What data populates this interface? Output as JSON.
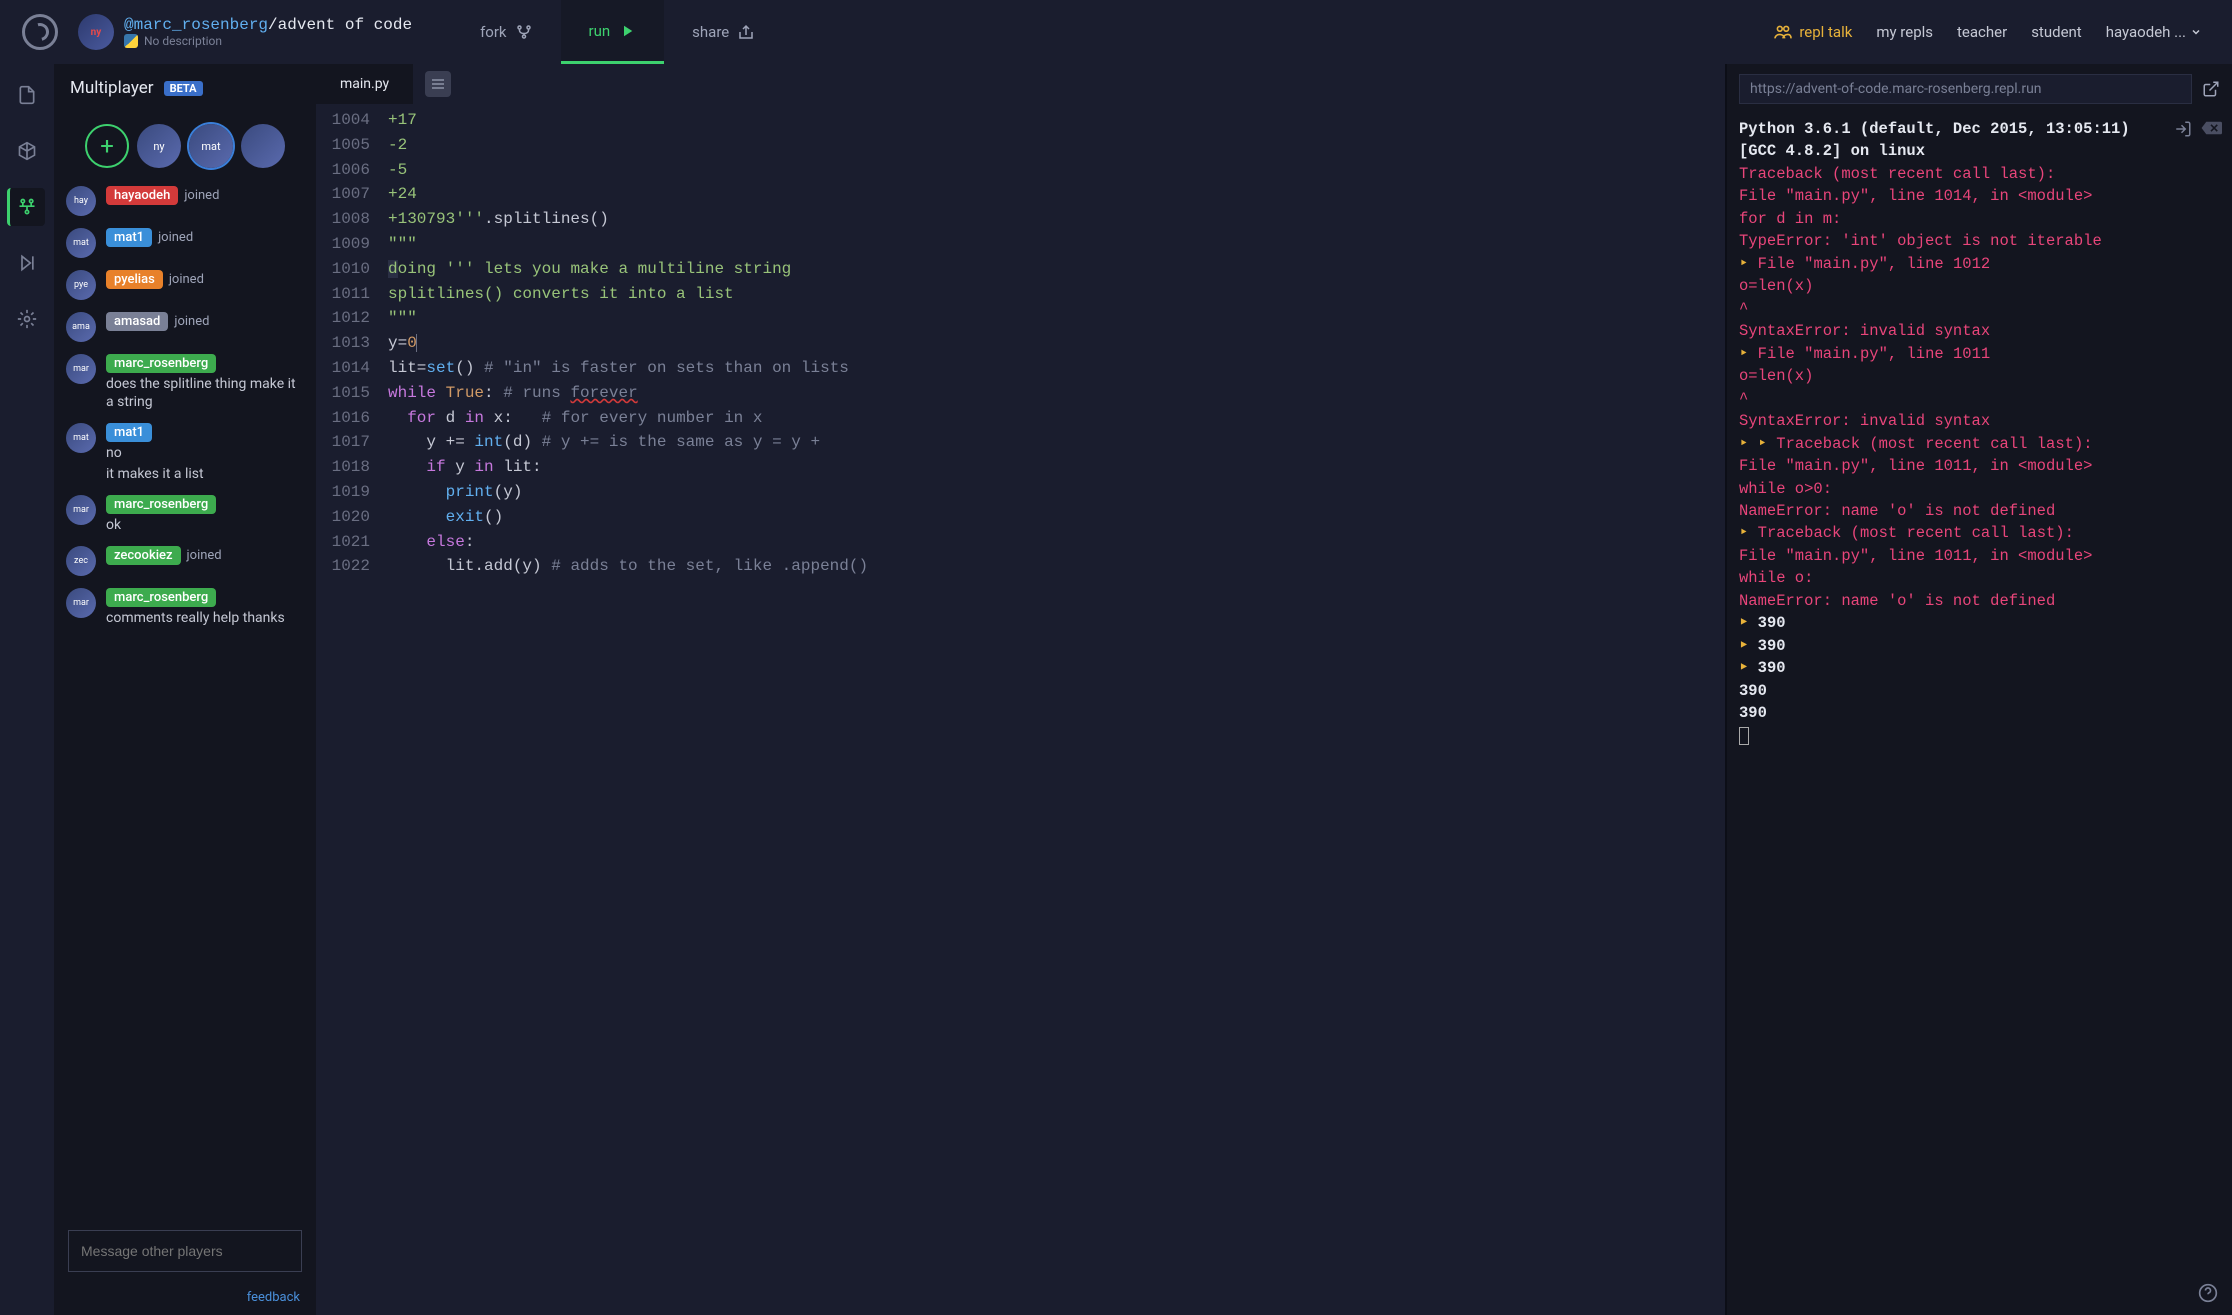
{
  "header": {
    "owner": "@marc_rosenberg",
    "repl_name": "advent of code",
    "description": "No description",
    "actions": {
      "fork": "fork",
      "run": "run",
      "share": "share"
    },
    "nav": {
      "repl_talk": "repl talk",
      "my_repls": "my repls",
      "teacher": "teacher",
      "student": "student",
      "user": "hayaodeh ..."
    }
  },
  "sidebar": {
    "title": "Multiplayer",
    "beta": "BETA",
    "chat": [
      {
        "name": "hayaodeh",
        "pill": "pill-red",
        "status": "joined"
      },
      {
        "name": "mat1",
        "pill": "pill-blue",
        "status": "joined"
      },
      {
        "name": "pyelias",
        "pill": "pill-orange",
        "status": "joined"
      },
      {
        "name": "amasad",
        "pill": "pill-gray",
        "status": "joined"
      },
      {
        "name": "marc_rosenberg",
        "pill": "pill-green",
        "msg": "does the splitline thing make it a string"
      },
      {
        "name": "mat1",
        "pill": "pill-blue",
        "msg": "no",
        "msg2": "it makes it a list"
      },
      {
        "name": "marc_rosenberg",
        "pill": "pill-green",
        "msg": "ok"
      },
      {
        "name": "zecookiez",
        "pill": "pill-green",
        "status": "joined"
      },
      {
        "name": "marc_rosenberg",
        "pill": "pill-green",
        "msg": "comments really help thanks"
      }
    ],
    "input_placeholder": "Message other players",
    "feedback": "feedback"
  },
  "editor": {
    "tab": "main.py",
    "lines": [
      {
        "n": "1004",
        "html": "<span class='tk-str'>+17</span>"
      },
      {
        "n": "1005",
        "html": "<span class='tk-str'>-2</span>"
      },
      {
        "n": "1006",
        "html": "<span class='tk-str'>-5</span>"
      },
      {
        "n": "1007",
        "html": "<span class='tk-str'>+24</span>"
      },
      {
        "n": "1008",
        "html": "<span class='tk-str'>+130793'''</span>.splitlines()"
      },
      {
        "n": "1009",
        "html": "<span class='tk-str'>\"\"\"</span>"
      },
      {
        "n": "1010",
        "html": "<span class='tk-str'><span class='sel'>d</span>oing ''' lets you make a multiline string</span>"
      },
      {
        "n": "1011",
        "html": "<span class='tk-str'>splitlines() converts it into a list</span>"
      },
      {
        "n": "1012",
        "html": "<span class='tk-str'>\"\"\"</span>"
      },
      {
        "n": "1013",
        "html": "y=<span class='tk-num'>0</span><span class='cursor-line'></span>"
      },
      {
        "n": "1014",
        "html": "lit=<span class='tk-fn'>set</span>() <span class='tk-cm'># \"in\" is faster on sets than on lists</span>"
      },
      {
        "n": "1015",
        "html": "<span class='tk-key'>while</span> <span class='tk-bool'>True</span>: <span class='tk-cm'># runs <span class='wavy'>forever</span></span>"
      },
      {
        "n": "1016",
        "html": "  <span class='tk-key'>for</span> d <span class='tk-key'>in</span> x:   <span class='tk-cm'># for every number in x</span>"
      },
      {
        "n": "1017",
        "html": "    y += <span class='tk-fn'>int</span>(d) <span class='tk-cm'># y += is the same as y = y +</span>"
      },
      {
        "n": "1018",
        "html": "    <span class='tk-key'>if</span> y <span class='tk-key'>in</span> lit:"
      },
      {
        "n": "1019",
        "html": "      <span class='tk-fn'>print</span>(y)"
      },
      {
        "n": "1020",
        "html": "      <span class='tk-fn'>exit</span>()"
      },
      {
        "n": "1021",
        "html": "    <span class='tk-key'>else</span>:"
      },
      {
        "n": "1022",
        "html": "      lit.add(y) <span class='tk-cm'># adds to the set, like .append()</span>"
      }
    ]
  },
  "console": {
    "url": "https://advent-of-code.marc-rosenberg.repl.run",
    "lines": [
      {
        "cls": "con-head",
        "t": "Python 3.6.1 (default, Dec 2015, 13:05:11)"
      },
      {
        "cls": "con-head",
        "t": "[GCC 4.8.2] on linux"
      },
      {
        "cls": "con-err",
        "t": "Traceback (most recent call last):"
      },
      {
        "cls": "con-err",
        "t": "  File \"main.py\", line 1014, in <module>"
      },
      {
        "cls": "con-err",
        "t": "    for d in m:"
      },
      {
        "cls": "con-err",
        "t": "TypeError: 'int' object is not iterable"
      },
      {
        "cls": "con-err",
        "pre": "1",
        "t": "  File \"main.py\", line 1012"
      },
      {
        "cls": "con-err",
        "t": "    o=len(x)"
      },
      {
        "cls": "con-err",
        "t": "    ^"
      },
      {
        "cls": "con-err",
        "t": "SyntaxError: invalid syntax"
      },
      {
        "cls": "con-err",
        "pre": "1",
        "t": "  File \"main.py\", line 1011"
      },
      {
        "cls": "con-err",
        "t": "    o=len(x)"
      },
      {
        "cls": "con-err",
        "t": "    ^"
      },
      {
        "cls": "con-err",
        "t": "SyntaxError: invalid syntax"
      },
      {
        "cls": "con-err",
        "pre": "2",
        "t": "Traceback (most recent call last):"
      },
      {
        "cls": "con-err",
        "t": "  File \"main.py\", line 1011, in <module>"
      },
      {
        "cls": "con-err",
        "t": "    while o>0:"
      },
      {
        "cls": "con-err",
        "t": "NameError: name 'o' is not defined"
      },
      {
        "cls": "con-err",
        "pre": "1",
        "t": "Traceback (most recent call last):"
      },
      {
        "cls": "con-err",
        "t": "  File \"main.py\", line 1011, in <module>"
      },
      {
        "cls": "con-err",
        "t": "    while o:"
      },
      {
        "cls": "con-err",
        "t": "NameError: name 'o' is not defined"
      },
      {
        "cls": "con-out",
        "pre": "1",
        "t": "390"
      },
      {
        "cls": "con-out",
        "pre": "1",
        "t": "390"
      },
      {
        "cls": "con-out",
        "pre": "1",
        "t": "390"
      },
      {
        "cls": "con-out",
        "t": "390"
      },
      {
        "cls": "con-out",
        "t": "390"
      }
    ]
  }
}
